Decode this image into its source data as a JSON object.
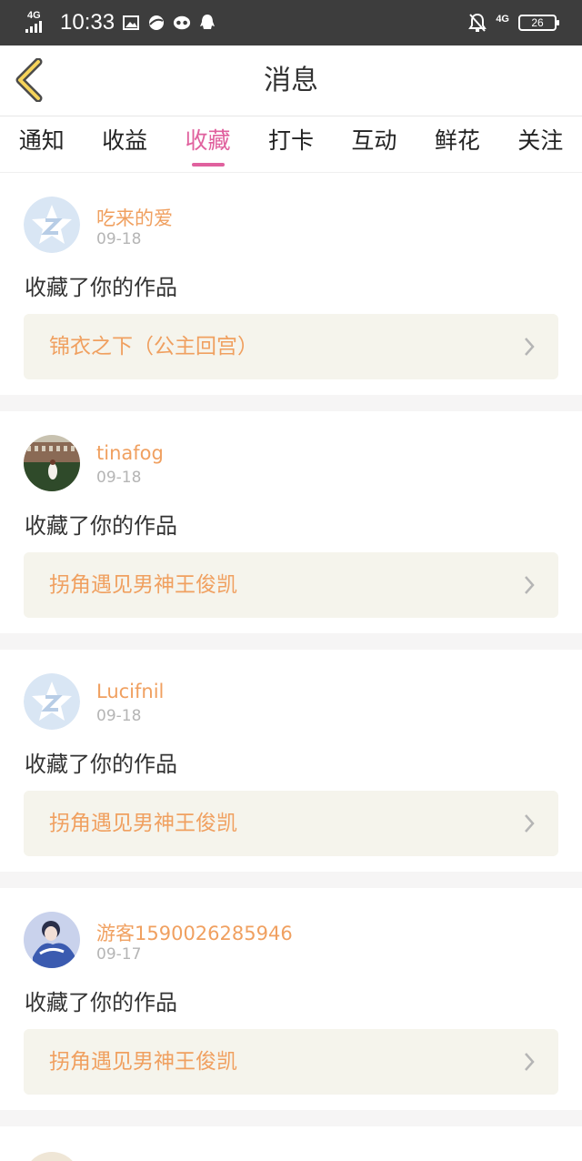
{
  "status": {
    "time": "10:33",
    "signal_label": "4G",
    "net_label": "4G",
    "battery": "26"
  },
  "header": {
    "title": "消息",
    "back_icon": "chevron-left-icon"
  },
  "tabs": [
    {
      "label": "通知"
    },
    {
      "label": "收益"
    },
    {
      "label": "收藏"
    },
    {
      "label": "打卡"
    },
    {
      "label": "互动"
    },
    {
      "label": "鲜花"
    },
    {
      "label": "关注"
    }
  ],
  "active_tab": "收藏",
  "colors": {
    "accent": "#e0619e",
    "name": "#f0a060",
    "work_bg": "#f5f4ec"
  },
  "items": [
    {
      "username": "吃来的爱",
      "date": "09-18",
      "action": "收藏了你的作品",
      "work": "锦衣之下（公主回宫）",
      "avatar": "default-avatar-icon"
    },
    {
      "username": "tinafog",
      "date": "09-18",
      "action": "收藏了你的作品",
      "work": "拐角遇见男神王俊凯",
      "avatar": "photo-avatar"
    },
    {
      "username": "Lucifnil",
      "date": "09-18",
      "action": "收藏了你的作品",
      "work": "拐角遇见男神王俊凯",
      "avatar": "default-avatar-icon"
    },
    {
      "username": "游客1590026285946",
      "date": "09-17",
      "action": "收藏了你的作品",
      "work": "拐角遇见男神王俊凯",
      "avatar": "photo-avatar"
    }
  ]
}
